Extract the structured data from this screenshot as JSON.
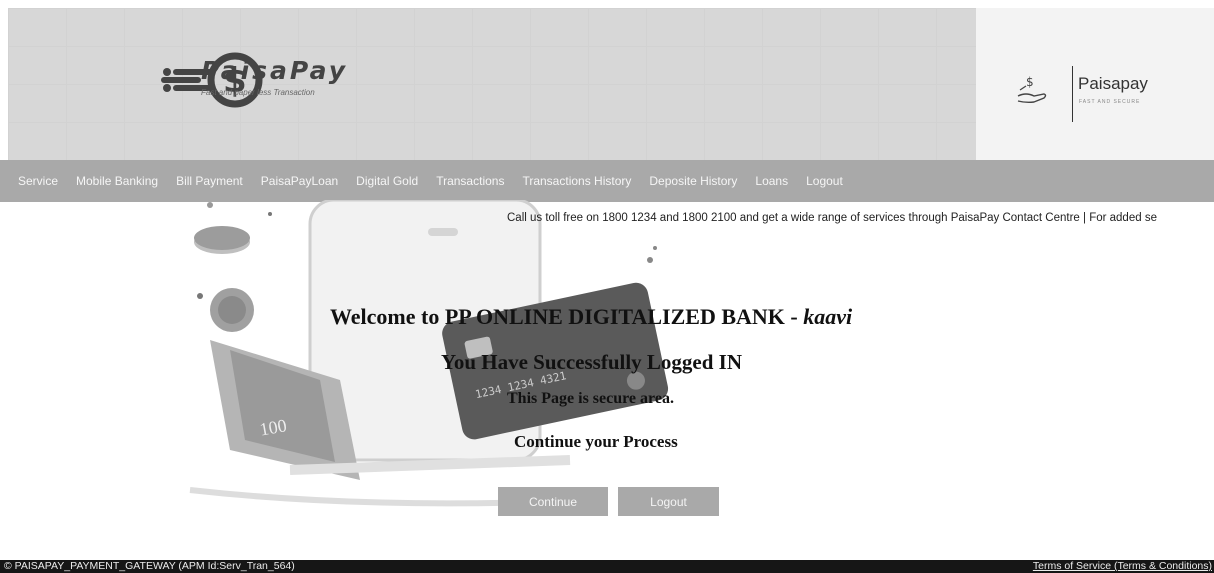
{
  "brand": {
    "title": "PaisaPay",
    "tagline": "Fast and paper less Transaction",
    "right_name": "Paisapay",
    "right_sub": "FAST AND SECURE"
  },
  "nav": [
    "Service",
    "Mobile Banking",
    "Bill Payment",
    "PaisaPayLoan",
    "Digital Gold",
    "Transactions",
    "Transactions History",
    "Deposite History",
    "Loans",
    "Logout"
  ],
  "ticker": "Call us toll free on 1800 1234 and 1800 2100 and get a wide range of services through PaisaPay Contact Centre | For added se",
  "main": {
    "welcome": "Welcome to PP ONLINE DIGITALIZED BANK - ",
    "username": "kaavi",
    "success": "You Have Successfully Logged IN",
    "secure": "This Page is secure area.",
    "continue_text": "Continue your Process",
    "continue_button": "Continue",
    "logout_button": "Logout"
  },
  "illustration": {
    "note_value": "100",
    "card_number": "1234 1234 4321"
  },
  "footer": {
    "left": "© PAISAPAY_PAYMENT_GATEWAY (APM Id:Serv_Tran_564)",
    "right": "Terms of Service (Terms & Conditions)"
  }
}
